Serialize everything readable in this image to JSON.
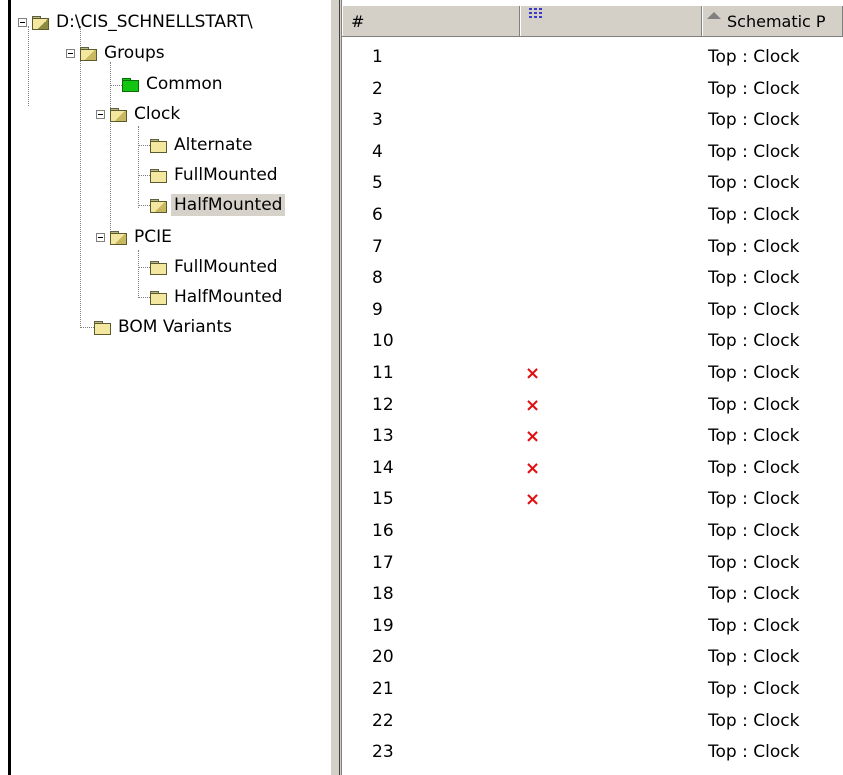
{
  "tree": {
    "root": {
      "label": "D:\\CIS_SCHNELLSTART\\"
    },
    "groups": {
      "label": "Groups"
    },
    "common": {
      "label": "Common"
    },
    "clock": {
      "label": "Clock"
    },
    "clock_alternate": {
      "label": "Alternate"
    },
    "clock_full": {
      "label": "FullMounted"
    },
    "clock_half": {
      "label": "HalfMounted"
    },
    "pcie": {
      "label": "PCIE"
    },
    "pcie_full": {
      "label": "FullMounted"
    },
    "pcie_half": {
      "label": "HalfMounted"
    },
    "bom": {
      "label": "BOM Variants"
    }
  },
  "grid": {
    "headers": {
      "number": "#",
      "schematic": "Schematic P"
    },
    "mark_symbol": "×",
    "rows": [
      {
        "num": "1",
        "mark": "",
        "schematic": "Top : Clock"
      },
      {
        "num": "2",
        "mark": "",
        "schematic": "Top : Clock"
      },
      {
        "num": "3",
        "mark": "",
        "schematic": "Top : Clock"
      },
      {
        "num": "4",
        "mark": "",
        "schematic": "Top : Clock"
      },
      {
        "num": "5",
        "mark": "",
        "schematic": "Top : Clock"
      },
      {
        "num": "6",
        "mark": "",
        "schematic": "Top : Clock"
      },
      {
        "num": "7",
        "mark": "",
        "schematic": "Top : Clock"
      },
      {
        "num": "8",
        "mark": "",
        "schematic": "Top : Clock"
      },
      {
        "num": "9",
        "mark": "",
        "schematic": "Top : Clock"
      },
      {
        "num": "10",
        "mark": "",
        "schematic": "Top : Clock"
      },
      {
        "num": "11",
        "mark": "×",
        "schematic": "Top : Clock"
      },
      {
        "num": "12",
        "mark": "×",
        "schematic": "Top : Clock"
      },
      {
        "num": "13",
        "mark": "×",
        "schematic": "Top : Clock"
      },
      {
        "num": "14",
        "mark": "×",
        "schematic": "Top : Clock"
      },
      {
        "num": "15",
        "mark": "×",
        "schematic": "Top : Clock"
      },
      {
        "num": "16",
        "mark": "",
        "schematic": "Top : Clock"
      },
      {
        "num": "17",
        "mark": "",
        "schematic": "Top : Clock"
      },
      {
        "num": "18",
        "mark": "",
        "schematic": "Top : Clock"
      },
      {
        "num": "19",
        "mark": "",
        "schematic": "Top : Clock"
      },
      {
        "num": "20",
        "mark": "",
        "schematic": "Top : Clock"
      },
      {
        "num": "21",
        "mark": "",
        "schematic": "Top : Clock"
      },
      {
        "num": "22",
        "mark": "",
        "schematic": "Top : Clock"
      },
      {
        "num": "23",
        "mark": "",
        "schematic": "Top : Clock"
      }
    ]
  },
  "colors": {
    "mark": "#e01010",
    "selection": "#d6d2ca",
    "common_folder": "#11c511",
    "folder": "#f4e7a0"
  },
  "icons": {
    "folder": "folder-icon",
    "open_folder": "open-folder-icon",
    "drive": "drive-folder-icon",
    "expander": "collapse-icon",
    "mark": "cross-mark-icon",
    "sort": "sort-ascending-icon",
    "variant": "variant-column-icon"
  }
}
